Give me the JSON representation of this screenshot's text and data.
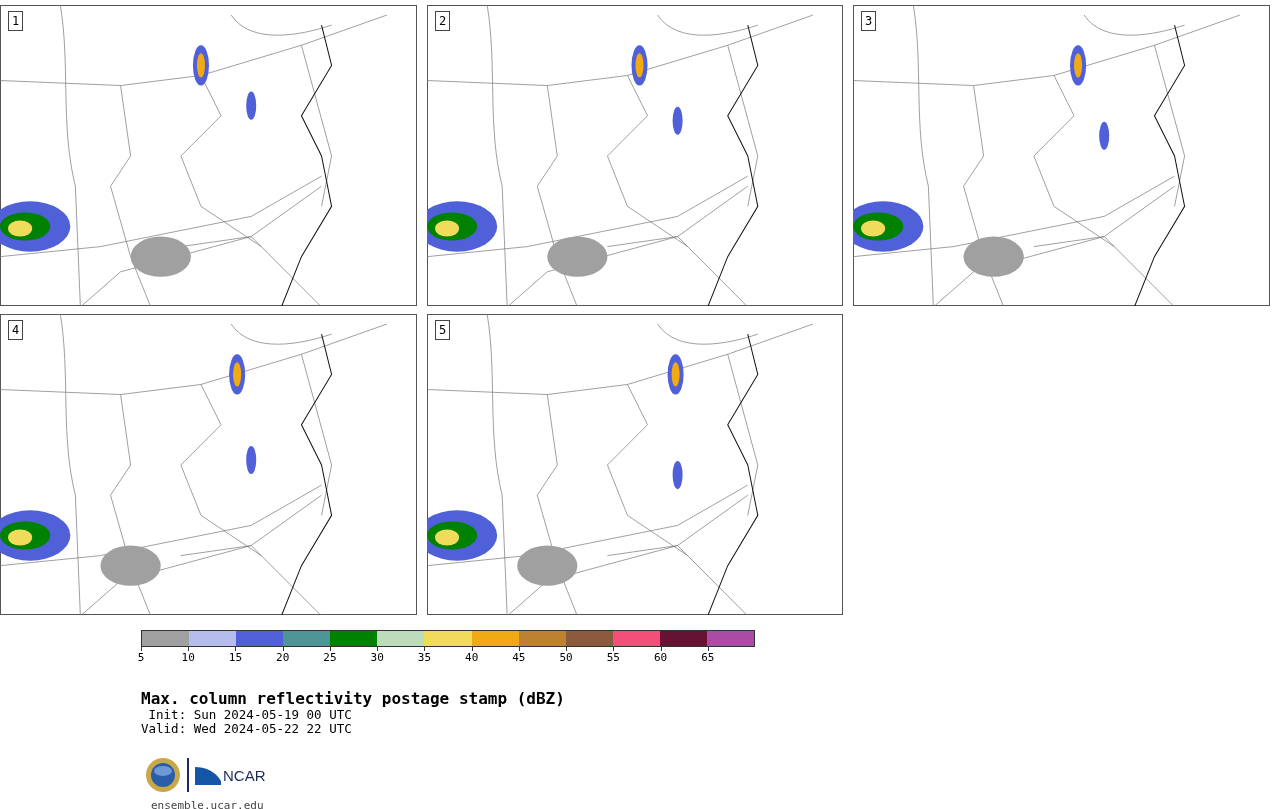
{
  "panels": [
    {
      "label": "1"
    },
    {
      "label": "2"
    },
    {
      "label": "3"
    },
    {
      "label": "4"
    },
    {
      "label": "5"
    }
  ],
  "colorbar": {
    "segments": [
      {
        "color": "#a0a0a0"
      },
      {
        "color": "#b4bdec"
      },
      {
        "color": "#5060d8"
      },
      {
        "color": "#4f9598"
      },
      {
        "color": "#008200"
      },
      {
        "color": "#bcdcbc"
      },
      {
        "color": "#f0dc5a"
      },
      {
        "color": "#f0aa14"
      },
      {
        "color": "#bc8230"
      },
      {
        "color": "#8c5a3c"
      },
      {
        "color": "#f44e7a"
      },
      {
        "color": "#641432"
      },
      {
        "color": "#aa4ca6"
      }
    ],
    "ticks": [
      "5",
      "10",
      "15",
      "20",
      "25",
      "30",
      "35",
      "40",
      "45",
      "50",
      "55",
      "60",
      "65"
    ]
  },
  "title": "Max. column reflectivity postage stamp (dBZ)",
  "init": " Init: Sun 2024-05-19 00 UTC",
  "valid": "Valid: Wed 2024-05-22 22 UTC",
  "logo": {
    "ncar": "NCAR"
  },
  "site": "ensemble.ucar.edu"
}
